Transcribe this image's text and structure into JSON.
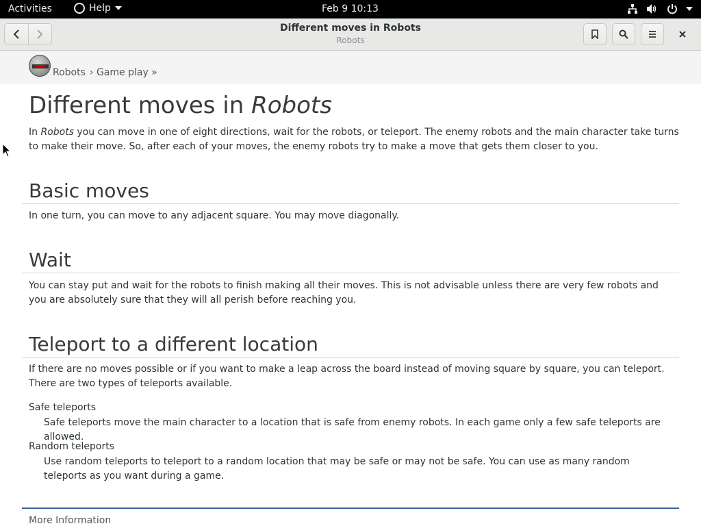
{
  "topbar": {
    "activities": "Activities",
    "app_menu": "Help",
    "clock": "Feb 9  10:13"
  },
  "headerbar": {
    "title": "Different moves in Robots",
    "subtitle": "Robots"
  },
  "breadcrumb": {
    "items": [
      "Robots",
      "› Game play »"
    ]
  },
  "page": {
    "title_prefix": "Different moves in ",
    "title_italic": "Robots",
    "intro_prefix": "In ",
    "intro_italic": "Robots",
    "intro_rest": " you can move in one of eight directions, wait for the robots, or teleport. The enemy robots and the main character take turns to make their move. So, after each of your moves, the enemy robots try to make a move that gets them closer to you.",
    "sections": [
      {
        "heading": "Basic moves",
        "text": "In one turn, you can move to any adjacent square. You may move diagonally."
      },
      {
        "heading": "Wait",
        "text": "You can stay put and wait for the robots to finish making all their moves. This is not advisable unless there are very few robots and you are absolutely sure that they will all perish before reaching you."
      },
      {
        "heading": "Teleport to a different location",
        "text": "If there are no moves possible or if you want to make a leap across the board instead of moving square by square, you can teleport. There are two types of teleports available."
      }
    ],
    "terms": [
      {
        "term": "Safe teleports",
        "desc": "Safe teleports move the main character to a location that is safe from enemy robots. In each game only a few safe teleports are allowed."
      },
      {
        "term": "Random teleports",
        "desc": "Use random teleports to teleport to a random location that may be safe or may not be safe. You can use as many random teleports as you want during a game."
      }
    ],
    "more_info": "More Information"
  },
  "colors": {
    "accent_rule": "#3465a4",
    "topbar_bg": "#000000",
    "headerbar_bg": "#e8e8e7"
  }
}
